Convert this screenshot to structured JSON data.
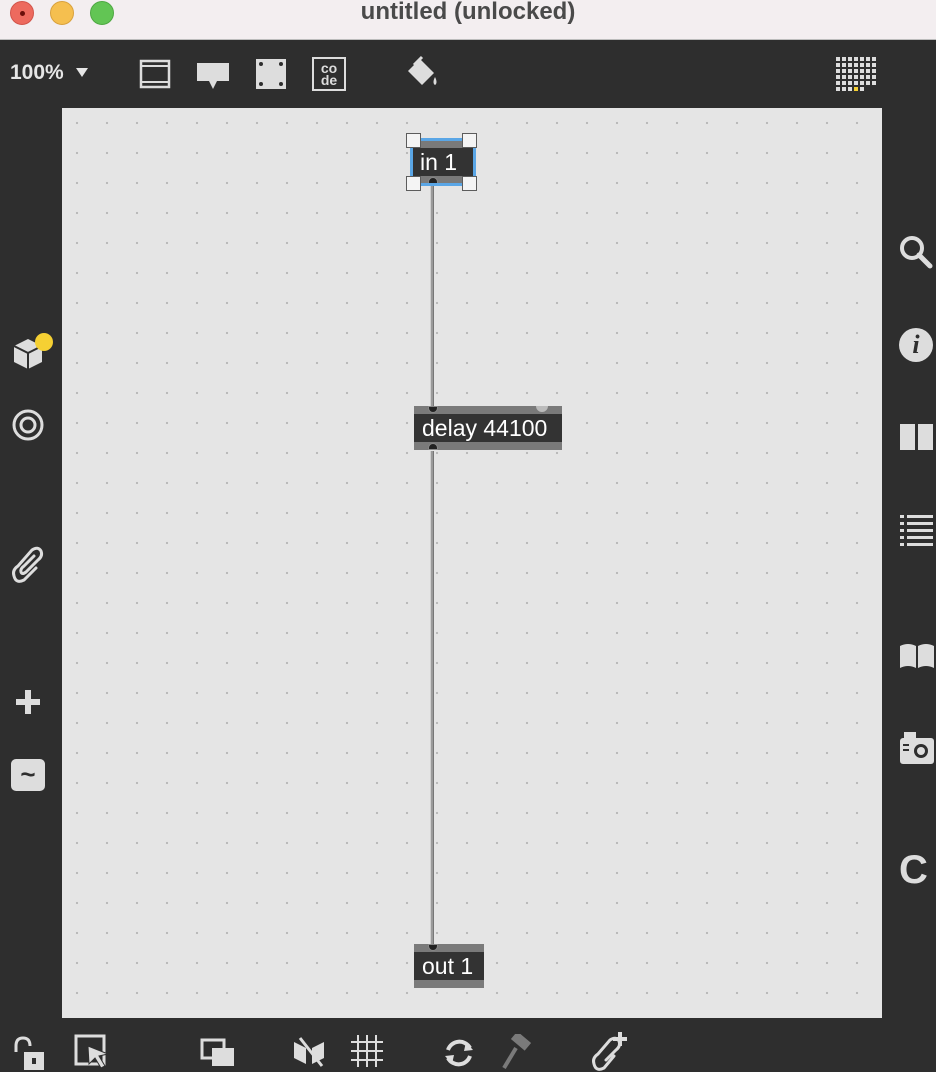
{
  "window": {
    "title": "untitled (unlocked)"
  },
  "toolbar": {
    "zoom": "100%",
    "icons": [
      "presentation-icon",
      "comment-icon",
      "fit-window-icon",
      "code-icon",
      "paint-bucket-icon",
      "grid-matrix-icon"
    ],
    "code_label_top": "co",
    "code_label_bottom": "de"
  },
  "left_sidebar": {
    "icons": [
      "package-cube-icon",
      "target-circle-icon",
      "paperclip-icon",
      "plus-icon",
      "tilde-icon"
    ],
    "tilde_label": "~"
  },
  "right_sidebar": {
    "icons": [
      "search-icon",
      "info-icon",
      "columns-icon",
      "list-icon",
      "book-icon",
      "snapshot-camera-icon",
      "clue-c-icon"
    ],
    "info_label": "i",
    "clue_label": "C"
  },
  "patcher": {
    "objects": [
      {
        "id": "in1",
        "label": "in 1",
        "selected": true
      },
      {
        "id": "delay",
        "label": "delay 44100",
        "selected": false
      },
      {
        "id": "out1",
        "label": "out 1",
        "selected": false
      }
    ],
    "connections": [
      {
        "from": "in 1",
        "to": "delay 44100"
      },
      {
        "from": "delay 44100",
        "to": "out 1"
      }
    ]
  },
  "bottom_bar": {
    "icons": [
      "lock-icon",
      "select-arrow-icon",
      "layers-icon",
      "hide-toggle-icon",
      "grid-icon",
      "refresh-icon",
      "hammer-icon",
      "add-attachment-icon"
    ]
  },
  "colors": {
    "background": "#2e2e2e",
    "canvas": "#e5e5e5",
    "selection": "#5aa6e6",
    "object": "#333333",
    "notification": "#f5d033"
  }
}
